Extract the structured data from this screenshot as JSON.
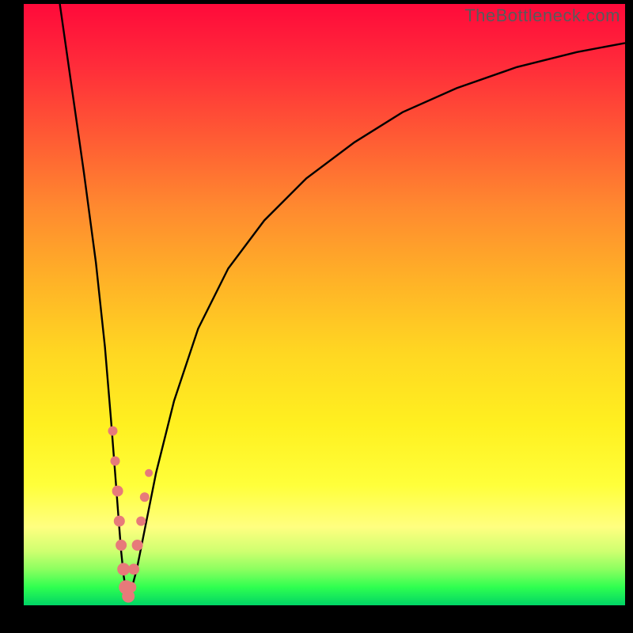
{
  "watermark": "TheBottleneck.com",
  "chart_data": {
    "type": "line",
    "title": "",
    "xlabel": "",
    "ylabel": "",
    "xlim": [
      0,
      100
    ],
    "ylim": [
      0,
      100
    ],
    "series": [
      {
        "name": "left-branch",
        "x": [
          6,
          8,
          10,
          12,
          13.5,
          14.5,
          15.2,
          15.8,
          16.2,
          16.6,
          17,
          17.4
        ],
        "y": [
          100,
          86,
          72,
          57,
          43,
          31,
          22,
          14,
          9,
          5,
          2.5,
          1.2
        ]
      },
      {
        "name": "right-branch",
        "x": [
          17.4,
          18,
          18.8,
          20,
          22,
          25,
          29,
          34,
          40,
          47,
          55,
          63,
          72,
          82,
          92,
          100
        ],
        "y": [
          1.2,
          3,
          6,
          12,
          22,
          34,
          46,
          56,
          64,
          71,
          77,
          82,
          86,
          89.5,
          92,
          93.5
        ]
      }
    ],
    "markers": {
      "name": "highlight-dots",
      "color": "#e77a7a",
      "points": [
        {
          "x": 14.8,
          "y": 29,
          "r": 6
        },
        {
          "x": 15.2,
          "y": 24,
          "r": 6
        },
        {
          "x": 15.6,
          "y": 19,
          "r": 7
        },
        {
          "x": 15.9,
          "y": 14,
          "r": 7
        },
        {
          "x": 16.2,
          "y": 10,
          "r": 7
        },
        {
          "x": 16.6,
          "y": 6,
          "r": 8
        },
        {
          "x": 17.0,
          "y": 3,
          "r": 9
        },
        {
          "x": 17.4,
          "y": 1.5,
          "r": 8
        },
        {
          "x": 17.8,
          "y": 3,
          "r": 7
        },
        {
          "x": 18.3,
          "y": 6,
          "r": 7
        },
        {
          "x": 18.9,
          "y": 10,
          "r": 7
        },
        {
          "x": 19.5,
          "y": 14,
          "r": 6
        },
        {
          "x": 20.1,
          "y": 18,
          "r": 6
        },
        {
          "x": 20.8,
          "y": 22,
          "r": 5
        }
      ]
    }
  }
}
